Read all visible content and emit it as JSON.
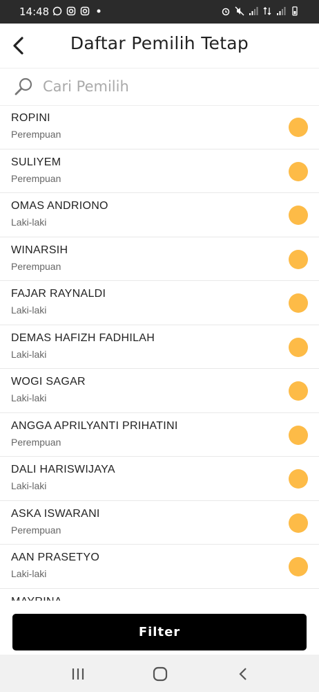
{
  "status": {
    "time": "14:48",
    "left_icons": [
      "whatsapp-icon",
      "instagram-icon",
      "instagram-icon",
      "dot-icon"
    ],
    "right_icons": [
      "alarm-icon",
      "mute-icon",
      "signal-icon",
      "data-icon",
      "signal-icon",
      "battery-icon"
    ]
  },
  "header": {
    "title": "Daftar Pemilih Tetap",
    "back_icon": "chevron-left-icon"
  },
  "search": {
    "placeholder": "Cari Pemilih",
    "value": ""
  },
  "voters": [
    {
      "name": "ROPINI",
      "gender": "Perempuan"
    },
    {
      "name": "SULIYEM",
      "gender": "Perempuan"
    },
    {
      "name": "OMAS ANDRIONO",
      "gender": "Laki-laki"
    },
    {
      "name": "WINARSIH",
      "gender": "Perempuan"
    },
    {
      "name": "FAJAR RAYNALDI",
      "gender": "Laki-laki"
    },
    {
      "name": "DEMAS HAFIZH FADHILAH",
      "gender": "Laki-laki"
    },
    {
      "name": "WOGI SAGAR",
      "gender": "Laki-laki"
    },
    {
      "name": "ANGGA APRILYANTI PRIHATINI",
      "gender": "Perempuan"
    },
    {
      "name": "DALI HARISWIJAYA",
      "gender": "Laki-laki"
    },
    {
      "name": "ASKA ISWARANI",
      "gender": "Perempuan"
    },
    {
      "name": "AAN PRASETYO",
      "gender": "Laki-laki"
    },
    {
      "name": "MAYRINA",
      "gender": ""
    }
  ],
  "colors": {
    "status_dot": "#fdbb47",
    "button": "#000000",
    "status_bar": "#2b2b2b"
  },
  "footer": {
    "filter_label": "Filter"
  },
  "navbar": {
    "icons": [
      "recent-apps-icon",
      "home-icon",
      "back-icon"
    ]
  }
}
